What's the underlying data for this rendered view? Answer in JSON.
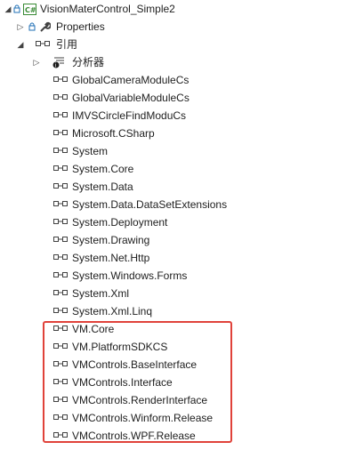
{
  "tree": {
    "project": {
      "label": "VisionMaterControl_Simple2",
      "icon": "csharp-project-icon"
    },
    "properties": {
      "label": "Properties",
      "icon": "wrench-icon"
    },
    "references": {
      "label": "引用",
      "icon": "references-icon"
    },
    "analyzers": {
      "label": "分析器",
      "icon": "analyzer-icon"
    },
    "refs": [
      "GlobalCameraModuleCs",
      "GlobalVariableModuleCs",
      "IMVSCircleFindModuCs",
      "Microsoft.CSharp",
      "System",
      "System.Core",
      "System.Data",
      "System.Data.DataSetExtensions",
      "System.Deployment",
      "System.Drawing",
      "System.Net.Http",
      "System.Windows.Forms",
      "System.Xml",
      "System.Xml.Linq",
      "VM.Core",
      "VM.PlatformSDKCS",
      "VMControls.BaseInterface",
      "VMControls.Interface",
      "VMControls.RenderInterface",
      "VMControls.Winform.Release",
      "VMControls.WPF.Release"
    ]
  },
  "colors": {
    "highlight": "#e0423a",
    "icon_blue": "#1f6fb5",
    "csharp_green": "#388a34"
  }
}
